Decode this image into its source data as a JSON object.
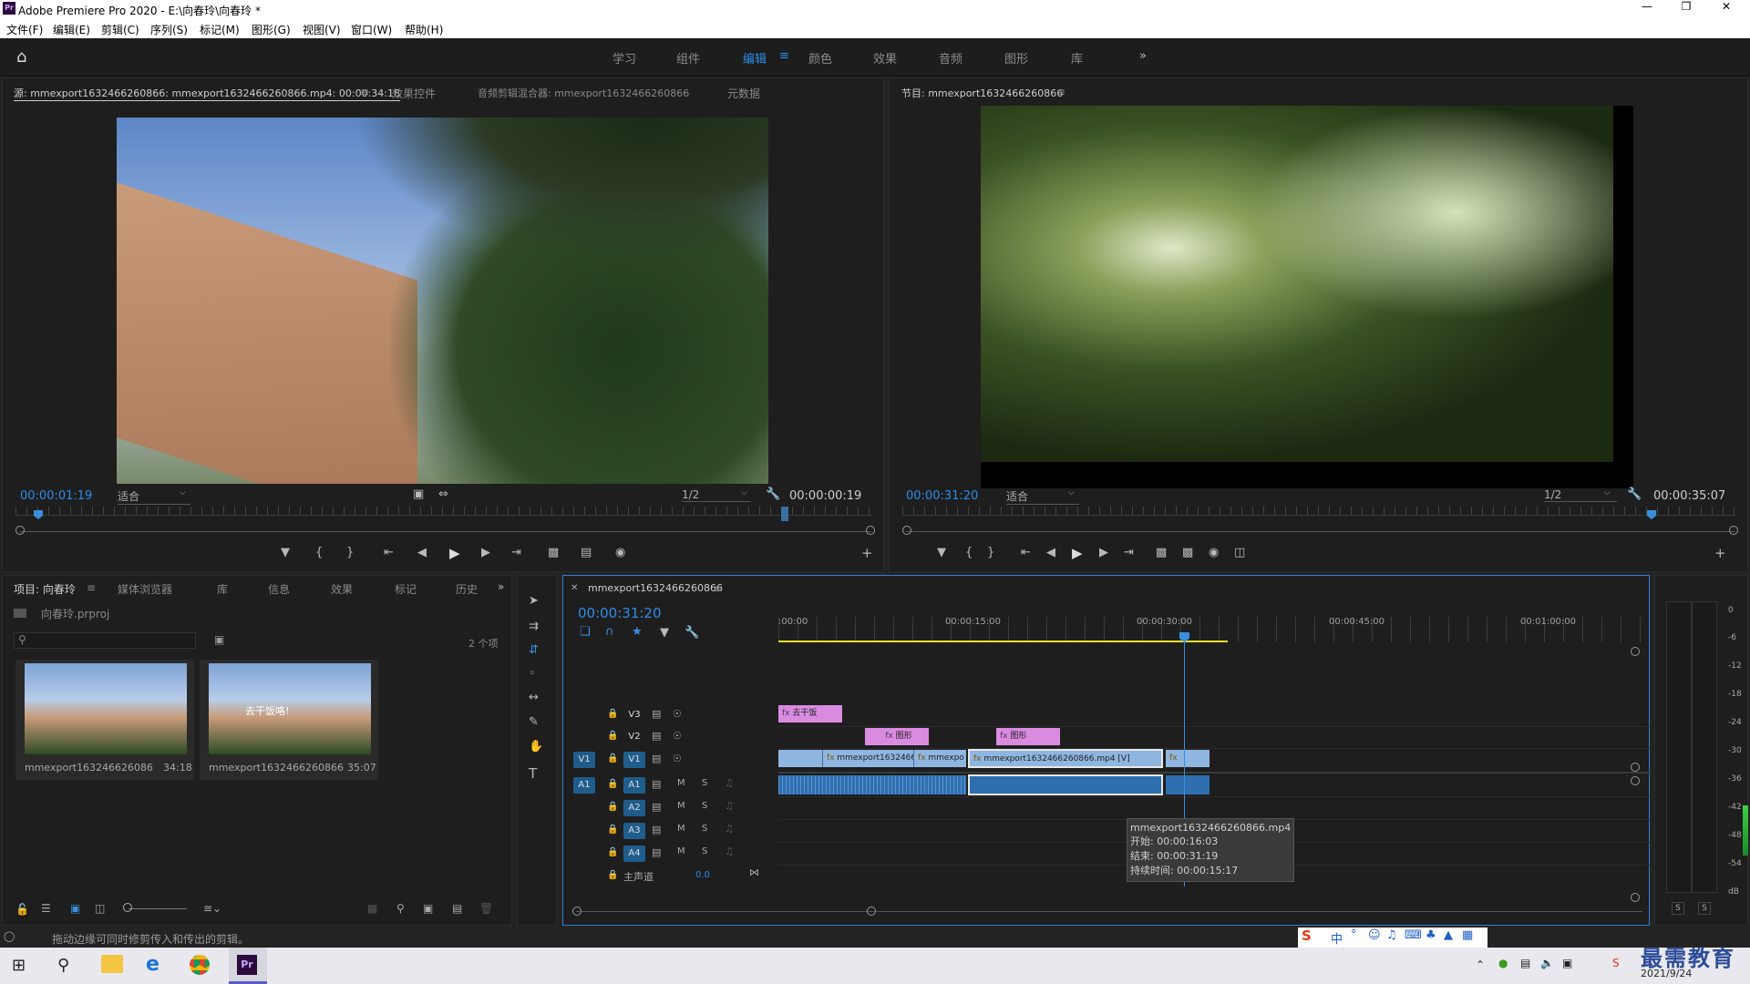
{
  "window": {
    "title": "Adobe Premiere Pro 2020 - E:\\向春玲\\向春玲 *",
    "app_icon": "Pr"
  },
  "menu": [
    "文件(F)",
    "编辑(E)",
    "剪辑(C)",
    "序列(S)",
    "标记(M)",
    "图形(G)",
    "视图(V)",
    "窗口(W)",
    "帮助(H)"
  ],
  "workspaces": [
    "学习",
    "组件",
    "编辑",
    "颜色",
    "效果",
    "音频",
    "图形",
    "库"
  ],
  "source_panel": {
    "tabs": [
      "源: mmexport1632466260866: mmexport1632466260866.mp4: 00:00:34:18",
      "效果控件",
      "音频剪辑混合器: mmexport1632466260866",
      "元数据"
    ],
    "timecode": "00:00:01:19",
    "fit": "适合",
    "resolution": "1/2",
    "duration": "00:00:00:19",
    "playhead_fraction": 0.025
  },
  "program_panel": {
    "tab": "节目: mmexport1632466260866",
    "timecode": "00:00:31:20",
    "fit": "适合",
    "resolution": "1/2",
    "duration": "00:00:35:07",
    "playhead_fraction": 0.904
  },
  "project_panel": {
    "tabs": [
      "项目: 向春玲",
      "媒体浏览器",
      "库",
      "信息",
      "效果",
      "标记",
      "历史"
    ],
    "file": "向春玲.prproj",
    "count": "2 个项",
    "items": [
      {
        "name": "mmexport1632466260866...",
        "duration": "34:18"
      },
      {
        "name": "mmexport1632466260866",
        "duration": "35:07",
        "overlay": "去干饭咯!"
      }
    ]
  },
  "timeline": {
    "tab": "mmexport1632466260866",
    "timecode": "00:00:31:20",
    "ruler": [
      ":00:00",
      "00:00:15:00",
      "00:00:30:00",
      "00:00:45:00",
      "00:01:00:00"
    ],
    "tracks": [
      {
        "id": "V3",
        "src": ""
      },
      {
        "id": "V2",
        "src": ""
      },
      {
        "id": "V1",
        "src": "V1"
      },
      {
        "id": "A1",
        "src": "A1"
      },
      {
        "id": "A2",
        "src": ""
      },
      {
        "id": "A3",
        "src": ""
      },
      {
        "id": "A4",
        "src": ""
      }
    ],
    "master": {
      "label": "主声道",
      "value": "0.0"
    },
    "clips": {
      "v3": [
        "去干饭"
      ],
      "v2": [
        "图形",
        "图形"
      ],
      "v1": [
        "mmexport1632466",
        "mmexpo",
        "mmexport1632466260866.mp4 [V]"
      ]
    },
    "tooltip": {
      "name": "mmexport1632466260866.mp4",
      "start": "开始: 00:00:16:03",
      "end": "结束: 00:00:31:19",
      "duration": "持续时间: 00:00:15:17"
    }
  },
  "audio_meter": {
    "scale": [
      "0",
      "-6",
      "-12",
      "-18",
      "-24",
      "-30",
      "-36",
      "-42",
      "-48",
      "-54",
      "dB"
    ],
    "solo": [
      "S",
      "S"
    ]
  },
  "status_bar": {
    "text": "拖动边缘可同时修剪传入和传出的剪辑。"
  },
  "taskbar": {
    "ime": "中",
    "date": "2021/9/24",
    "watermark": "最需教育"
  },
  "colors": {
    "accent": "#2d8ceb",
    "clip_pink": "#d98be0",
    "clip_blue": "#8fb6e0",
    "selected_clip": "#2e6fb0",
    "panel_bg": "#1e1e1e",
    "playhead": "#3a8fe0",
    "inout_bar": "#e8e030"
  }
}
